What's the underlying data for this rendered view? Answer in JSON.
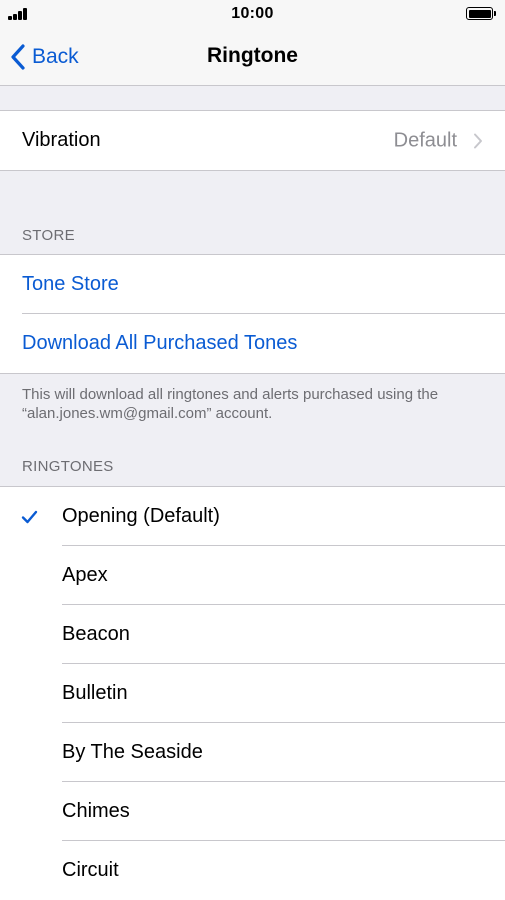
{
  "status_bar": {
    "time": "10:00",
    "signal_icon": "signal-bars-icon",
    "battery_icon": "battery-full-icon"
  },
  "nav": {
    "back_label": "Back",
    "title": "Ringtone"
  },
  "vibration": {
    "label": "Vibration",
    "value": "Default"
  },
  "store": {
    "header": "STORE",
    "items": [
      {
        "label": "Tone Store"
      },
      {
        "label": "Download All Purchased Tones"
      }
    ],
    "footer": "This will download all ringtones and alerts purchased using the “alan.jones.wm@gmail.com” account."
  },
  "ringtones": {
    "header": "RINGTONES",
    "items": [
      {
        "label": "Opening (Default)",
        "selected": true
      },
      {
        "label": "Apex",
        "selected": false
      },
      {
        "label": "Beacon",
        "selected": false
      },
      {
        "label": "Bulletin",
        "selected": false
      },
      {
        "label": "By The Seaside",
        "selected": false
      },
      {
        "label": "Chimes",
        "selected": false
      },
      {
        "label": "Circuit",
        "selected": false
      }
    ]
  },
  "colors": {
    "accent": "#0a5bd3",
    "secondary_text": "#8e8e93",
    "section_text": "#6d6d72",
    "background": "#efeff4"
  }
}
